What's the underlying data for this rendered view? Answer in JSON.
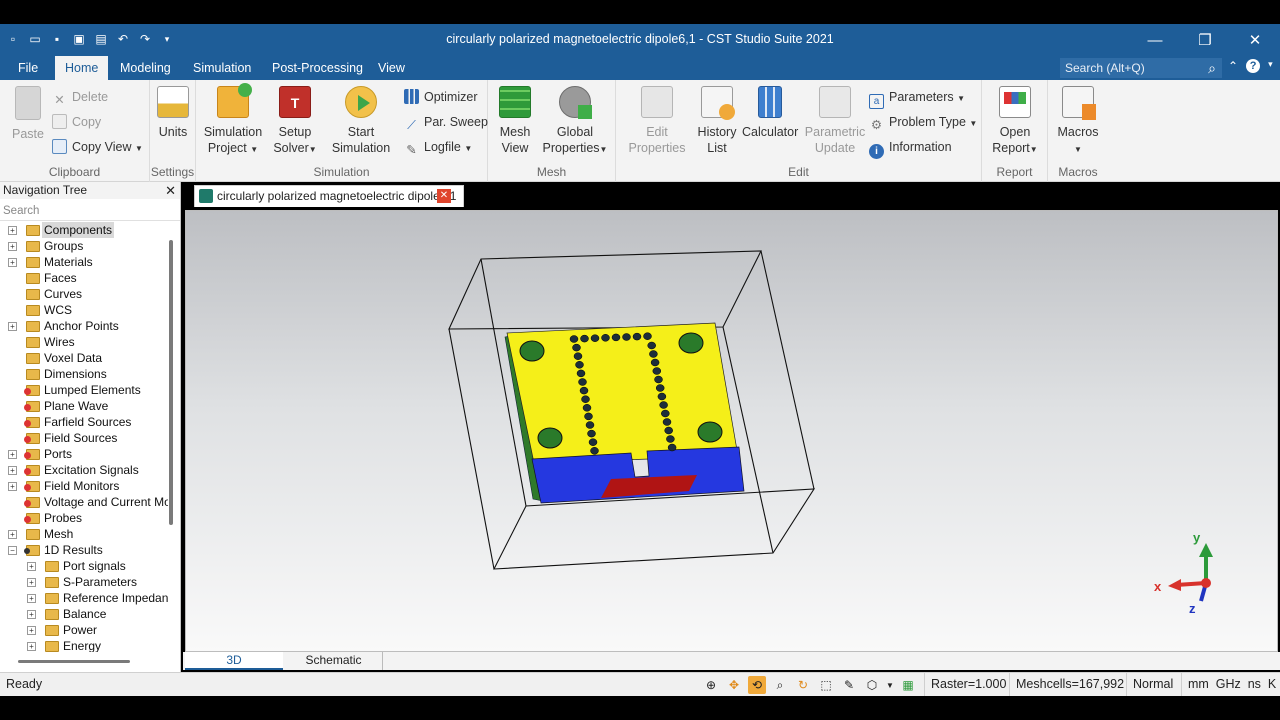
{
  "window": {
    "title": "circularly polarized magnetoelectric dipole6,1 - CST Studio Suite 2021",
    "minimize_icon": "minimize-icon",
    "restore_icon": "restore-icon",
    "close_icon": "close-icon"
  },
  "quick_access": [
    "new-icon",
    "open-icon",
    "save-icon",
    "save-all-icon",
    "print-icon",
    "undo-icon",
    "redo-icon",
    "customize-icon"
  ],
  "menu": {
    "file": "File",
    "tabs": [
      "Home",
      "Modeling",
      "Simulation",
      "Post-Processing",
      "View"
    ],
    "active_tab": "Home",
    "search_placeholder": "Search (Alt+Q)"
  },
  "ribbon": {
    "clipboard": {
      "label": "Clipboard",
      "paste": "Paste",
      "delete": "Delete",
      "copy": "Copy",
      "copy_view": "Copy View"
    },
    "settings": {
      "label": "Settings",
      "units": "Units"
    },
    "simulation": {
      "label": "Simulation",
      "sim_project_1": "Simulation",
      "sim_project_2": "Project",
      "setup_solver_1": "Setup",
      "setup_solver_2": "Solver",
      "start_sim_1": "Start",
      "start_sim_2": "Simulation",
      "optimizer": "Optimizer",
      "par_sweep": "Par. Sweep",
      "logfile": "Logfile"
    },
    "mesh": {
      "label": "Mesh",
      "mesh_view_1": "Mesh",
      "mesh_view_2": "View",
      "global_props_1": "Global",
      "global_props_2": "Properties"
    },
    "edit": {
      "label": "Edit",
      "edit_props_1": "Edit",
      "edit_props_2": "Properties",
      "history_1": "History",
      "history_2": "List",
      "calculator": "Calculator",
      "param_update_1": "Parametric",
      "param_update_2": "Update",
      "parameters": "Parameters",
      "problem_type": "Problem Type",
      "information": "Information"
    },
    "report": {
      "label": "Report",
      "open_report_1": "Open",
      "open_report_2": "Report"
    },
    "macros": {
      "label": "Macros",
      "macros": "Macros"
    }
  },
  "nav": {
    "title": "Navigation Tree",
    "search_placeholder": "Search",
    "items": [
      {
        "label": "Components",
        "icon": "folder-icon",
        "expand": true,
        "level": 0,
        "selected": true
      },
      {
        "label": "Groups",
        "icon": "folder-icon",
        "expand": true,
        "level": 0
      },
      {
        "label": "Materials",
        "icon": "folder-icon",
        "expand": true,
        "level": 0
      },
      {
        "label": "Faces",
        "icon": "folder-icon",
        "expand": false,
        "level": 0
      },
      {
        "label": "Curves",
        "icon": "folder-icon",
        "expand": false,
        "level": 0
      },
      {
        "label": "WCS",
        "icon": "folder-icon",
        "expand": false,
        "level": 0
      },
      {
        "label": "Anchor Points",
        "icon": "folder-icon",
        "expand": true,
        "level": 0
      },
      {
        "label": "Wires",
        "icon": "folder-icon",
        "expand": false,
        "level": 0
      },
      {
        "label": "Voxel Data",
        "icon": "folder-icon",
        "expand": false,
        "level": 0
      },
      {
        "label": "Dimensions",
        "icon": "folder-icon",
        "expand": false,
        "level": 0
      },
      {
        "label": "Lumped Elements",
        "icon": "folder-red-icon",
        "expand": false,
        "level": 0
      },
      {
        "label": "Plane Wave",
        "icon": "folder-red-icon",
        "expand": false,
        "level": 0
      },
      {
        "label": "Farfield Sources",
        "icon": "folder-red-icon",
        "expand": false,
        "level": 0
      },
      {
        "label": "Field Sources",
        "icon": "folder-red-icon",
        "expand": false,
        "level": 0
      },
      {
        "label": "Ports",
        "icon": "folder-red-icon",
        "expand": true,
        "level": 0
      },
      {
        "label": "Excitation Signals",
        "icon": "folder-red-icon",
        "expand": true,
        "level": 0
      },
      {
        "label": "Field Monitors",
        "icon": "folder-red-icon",
        "expand": true,
        "level": 0
      },
      {
        "label": "Voltage and Current Mon",
        "icon": "folder-red-icon",
        "expand": false,
        "level": 0
      },
      {
        "label": "Probes",
        "icon": "folder-red-icon",
        "expand": false,
        "level": 0
      },
      {
        "label": "Mesh",
        "icon": "folder-icon",
        "expand": true,
        "level": 0
      },
      {
        "label": "1D Results",
        "icon": "folder-results-icon",
        "expand": true,
        "expanded": true,
        "level": 0
      },
      {
        "label": "Port signals",
        "icon": "folder-icon",
        "expand": true,
        "level": 1
      },
      {
        "label": "S-Parameters",
        "icon": "folder-icon",
        "expand": true,
        "level": 1
      },
      {
        "label": "Reference Impedanc",
        "icon": "folder-icon",
        "expand": true,
        "level": 1
      },
      {
        "label": "Balance",
        "icon": "folder-icon",
        "expand": true,
        "level": 1
      },
      {
        "label": "Power",
        "icon": "folder-icon",
        "expand": true,
        "level": 1
      },
      {
        "label": "Energy",
        "icon": "folder-icon",
        "expand": true,
        "level": 1
      }
    ]
  },
  "document_tab": {
    "label": "circularly polarized magnetoelectric dipole6,1",
    "close_icon": "close-icon"
  },
  "axes": {
    "x": "x",
    "y": "y",
    "z": "z"
  },
  "view_tabs": [
    "3D",
    "Schematic"
  ],
  "active_view": "3D",
  "status": {
    "ready": "Ready",
    "raster": "Raster=1.000",
    "meshcells": "Meshcells=167,992",
    "mode": "Normal",
    "units": "mm  GHz  ns  K"
  }
}
